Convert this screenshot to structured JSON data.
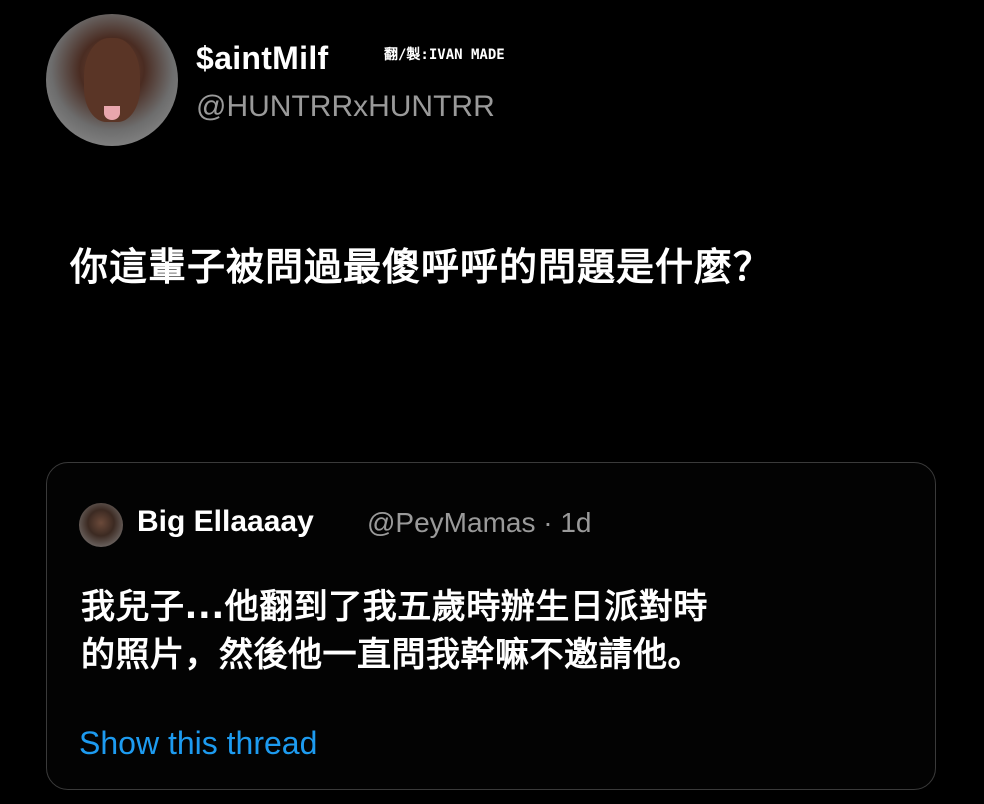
{
  "tweet": {
    "display_name": "$aintMilf",
    "watermark": "翻/製:IVAN MADE",
    "handle": "@HUNTRRxHUNTRR",
    "text": "你這輩子被問過最傻呼呼的問題是什麼？"
  },
  "quote": {
    "display_name": "Big Ellaaaay",
    "meta": "@PeyMamas · 1d",
    "body_line1": "我兒子...他翻到了我五歲時辦生日派對時",
    "body_line2": "的照片，然後他一直問我幹嘛不邀請他。",
    "show_thread": "Show this thread"
  },
  "colors": {
    "background": "#000000",
    "text_primary": "#ffffff",
    "text_secondary": "#9a9a9a",
    "link": "#1d9bf0",
    "card_border": "#3a3a3a"
  }
}
